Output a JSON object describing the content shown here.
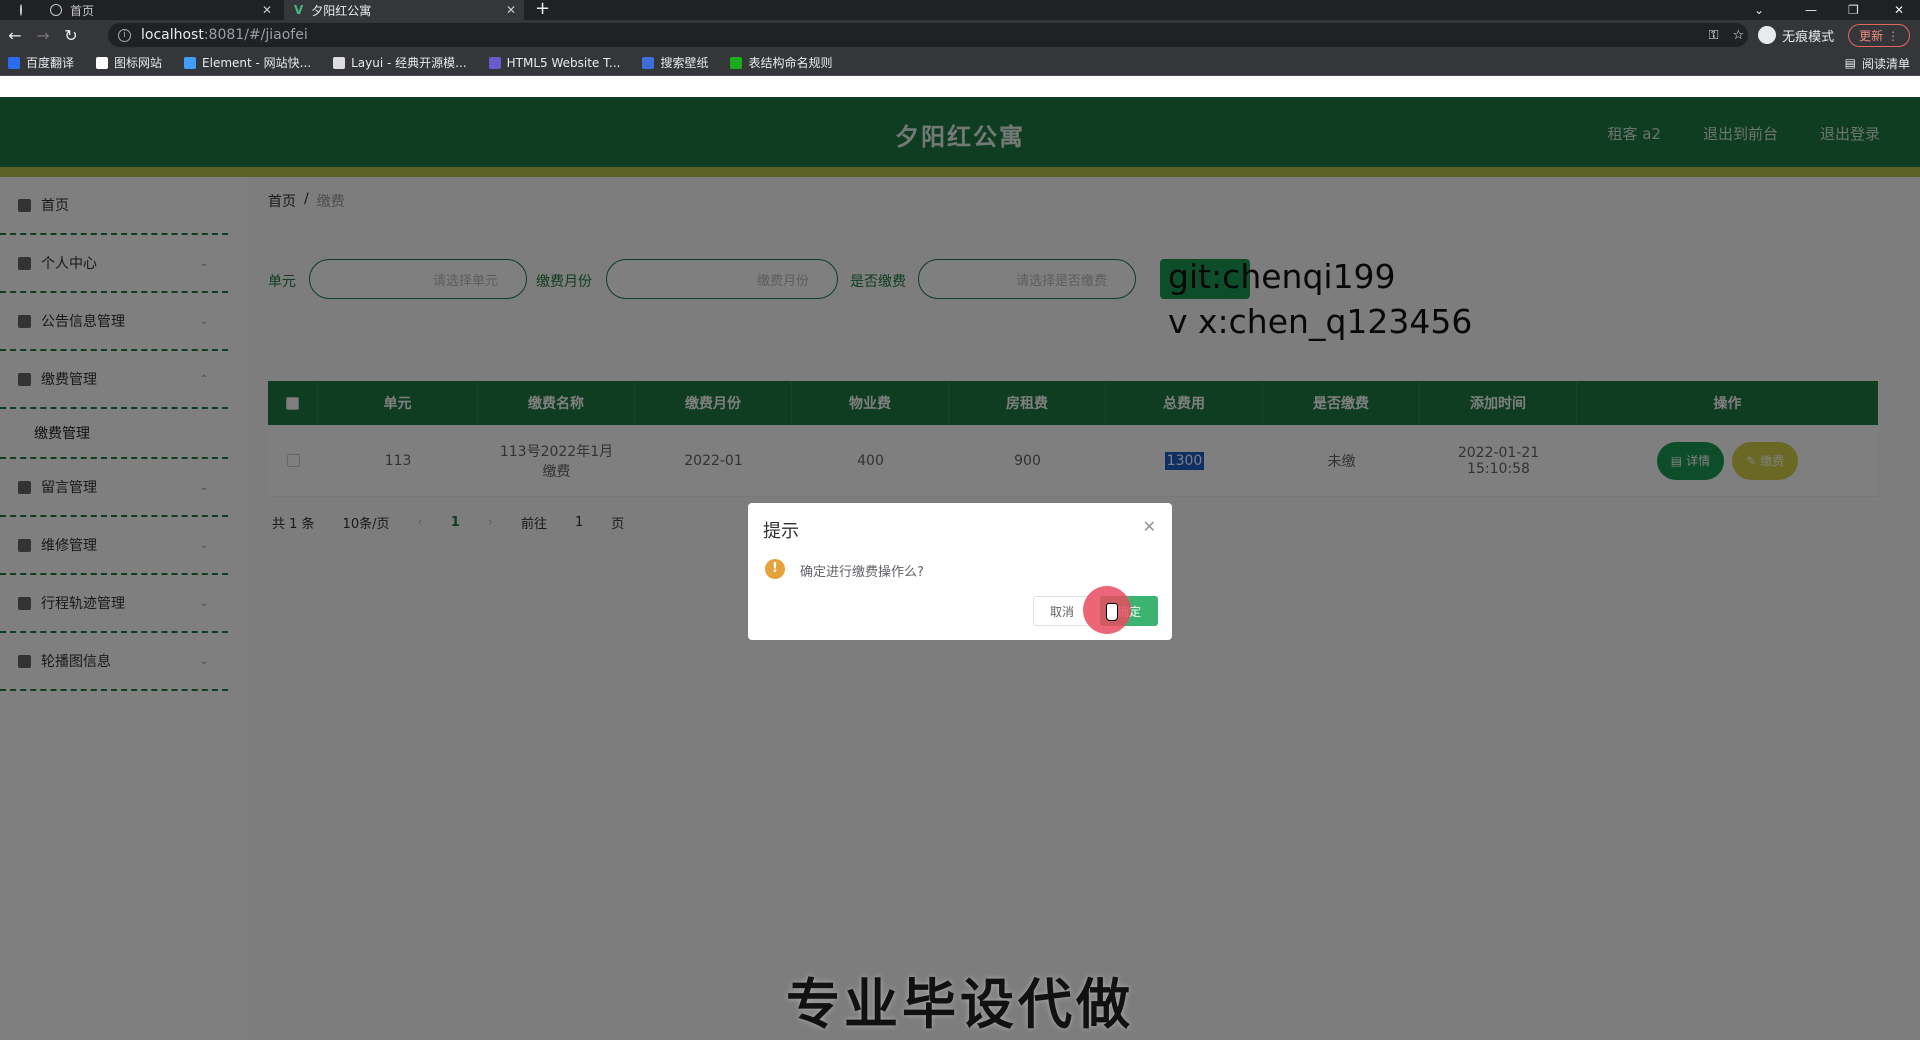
{
  "browser": {
    "tabs": [
      {
        "title": "首页"
      },
      {
        "title": "夕阳红公寓"
      }
    ],
    "url_host": "localhost",
    "url_path": ":8081/#/jiaofei",
    "incognito_label": "无痕模式",
    "update_label": "更新",
    "reading_list": "阅读清单",
    "bookmarks": [
      {
        "label": "百度翻译",
        "color": "#2a6df4"
      },
      {
        "label": "图标网站",
        "color": "#ffffff"
      },
      {
        "label": "Element - 网站快...",
        "color": "#409eff"
      },
      {
        "label": "Layui - 经典开源模...",
        "color": "#dddddd"
      },
      {
        "label": "HTML5 Website T...",
        "color": "#6a5acd"
      },
      {
        "label": "搜索壁纸",
        "color": "#3f6fd8"
      },
      {
        "label": "表结构命名规则",
        "color": "#1aad19"
      }
    ]
  },
  "app": {
    "title": "夕阳红公寓",
    "header_links": [
      "租客 a2",
      "退出到前台",
      "退出登录"
    ],
    "header_color": "#1c7a45",
    "stripe_color": "#b8c24a"
  },
  "sidebar": {
    "items": [
      {
        "label": "首页",
        "icon": "home-icon"
      },
      {
        "label": "个人中心",
        "icon": "user-icon"
      },
      {
        "label": "公告信息管理",
        "icon": "message-icon"
      },
      {
        "label": "缴费管理",
        "icon": "list-icon"
      },
      {
        "label": "缴费管理",
        "icon": ""
      },
      {
        "label": "留言管理",
        "icon": "edit-icon"
      },
      {
        "label": "维修管理",
        "icon": "tools-icon"
      },
      {
        "label": "行程轨迹管理",
        "icon": "location-icon"
      },
      {
        "label": "轮播图信息",
        "icon": "picture-icon"
      }
    ]
  },
  "breadcrumb": {
    "home": "首页",
    "sep": "/",
    "current": "缴费"
  },
  "search": {
    "unit_label": "单元",
    "unit_placeholder": "请选择单元",
    "month_label": "缴费月份",
    "month_placeholder": "缴费月份",
    "paid_label": "是否缴费",
    "paid_placeholder": "请选择是否缴费"
  },
  "watermark": {
    "line1": "git:chenqi199",
    "line2": "v x:chen_q123456"
  },
  "table": {
    "headers": [
      "单元",
      "缴费名称",
      "缴费月份",
      "物业费",
      "房租费",
      "总费用",
      "是否缴费",
      "添加时间",
      "操作"
    ],
    "rows": [
      {
        "unit": "113",
        "name": "113号2022年1月缴费",
        "month": "2022-01",
        "property_fee": "400",
        "rent": "900",
        "total": "1300",
        "paid": "未缴",
        "added": "2022-01-21 15:10:58",
        "detail_label": "详情",
        "pay_label": "缴费"
      }
    ]
  },
  "pager": {
    "total": "共 1 条",
    "size": "10条/页",
    "prev": "‹",
    "page": "1",
    "next": "›",
    "goto": "前往",
    "goto_value": "1",
    "page_suffix": "页"
  },
  "dialog": {
    "title": "提示",
    "message": "确定进行缴费操作么?",
    "cancel": "取消",
    "confirm": "确定"
  },
  "caption": "专业毕设代做"
}
